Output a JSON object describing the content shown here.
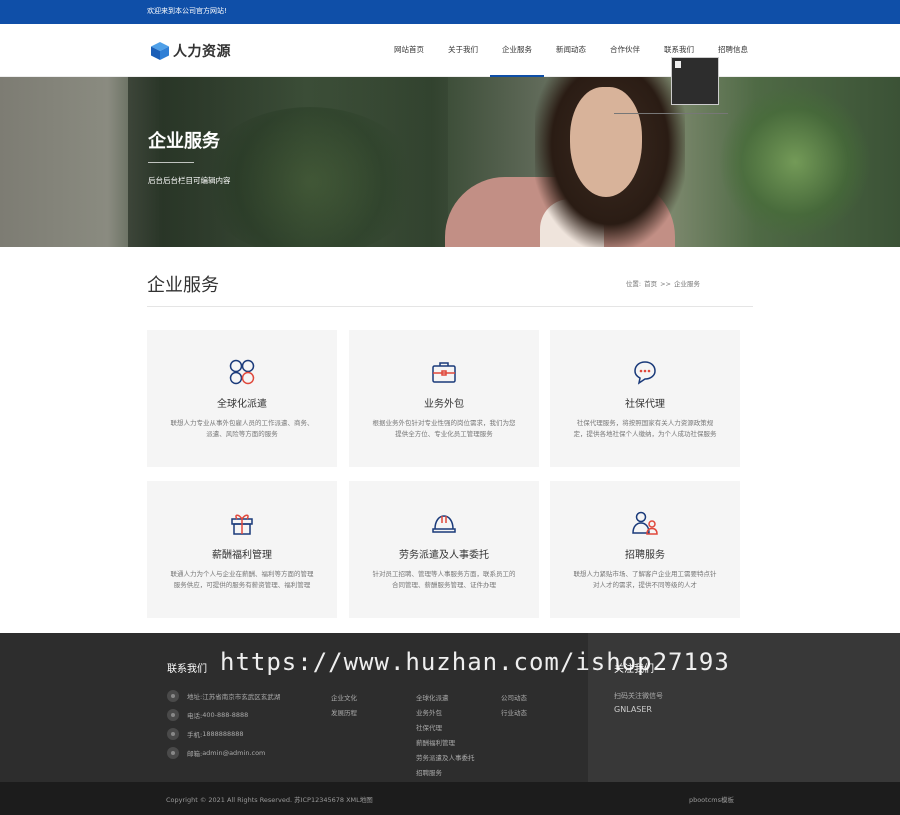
{
  "topbar": {
    "welcome": "欢迎来到本公司官方网站!"
  },
  "header": {
    "logo_text": "人力资源",
    "nav": [
      {
        "label": "网站首页"
      },
      {
        "label": "关于我们"
      },
      {
        "label": "企业服务"
      },
      {
        "label": "新闻动态"
      },
      {
        "label": "合作伙伴"
      },
      {
        "label": "联系我们"
      },
      {
        "label": "招聘信息"
      }
    ],
    "active_nav": "企业服务"
  },
  "banner": {
    "title": "企业服务",
    "subtitle": "后台后台栏目可编辑内容"
  },
  "section": {
    "title": "企业服务",
    "breadcrumb": {
      "prefix": "位置:",
      "home": "首页",
      "sep": ">>",
      "current": "企业服务"
    }
  },
  "services": [
    {
      "icon": "four-circles-icon",
      "title": "全球化派遣",
      "desc": "联想人力专业从事外包雇人员的工作派遣、商务、派遣、风险等方面的服务"
    },
    {
      "icon": "briefcase-icon",
      "title": "业务外包",
      "desc": "根据业务外包针对专业性强的岗位需求，我们为您提供全方位、专业化员工管理服务"
    },
    {
      "icon": "chat-bubbles-icon",
      "title": "社保代理",
      "desc": "社保代理服务，将按照国家有关人力资源政策规定，提供各地社保个人缴纳，为个人成功社保服务"
    },
    {
      "icon": "gift-icon",
      "title": "薪酬福利管理",
      "desc": "联通人力为个人与企业在薪酬、福利等方面的管理服务供应，可提供的服务有薪资管理、福利管理"
    },
    {
      "icon": "hard-hat-icon",
      "title": "劳务派遣及人事委托",
      "desc": "针对员工招聘、管理等人事服务方面，联系员工的合同管理、薪酬服务管理、证件办理"
    },
    {
      "icon": "people-icon",
      "title": "招聘服务",
      "desc": "联想人力紧贴市场、了解客户企业用工需要特点针对人才的需求，提供不同等级的人才"
    }
  ],
  "footer": {
    "contact_title": "联系我们",
    "contacts": [
      {
        "label": "地址:",
        "value": "江苏省南京市玄武区玄武湖"
      },
      {
        "label": "电话:",
        "value": "400-888-8888"
      },
      {
        "label": "手机:",
        "value": "1888888888"
      },
      {
        "label": "邮箱:",
        "value": "admin@admin.com"
      }
    ],
    "col2_links": [
      "企业文化",
      "发展历程"
    ],
    "col3_links": [
      "全球化派遣",
      "业务外包",
      "社保代理",
      "薪酬福利管理",
      "劳务派遣及人事委托",
      "招聘服务"
    ],
    "col4_links": [
      "公司动态",
      "行业动态"
    ],
    "qr_title": "关注我们",
    "qr_caption": "扫码关注微信号",
    "qr_name": "GNLASER",
    "watermark": "https://www.huzhan.com/ishop27193"
  },
  "bottombar": {
    "copyright": "Copyright © 2021 All Rights Reserved. 苏ICP12345678 XML地图",
    "brand": "pbootcms模板"
  },
  "colors": {
    "brand_blue": "#0f4fa8",
    "icon_red": "#e0483b",
    "footer_bg": "#2d2d2d"
  }
}
